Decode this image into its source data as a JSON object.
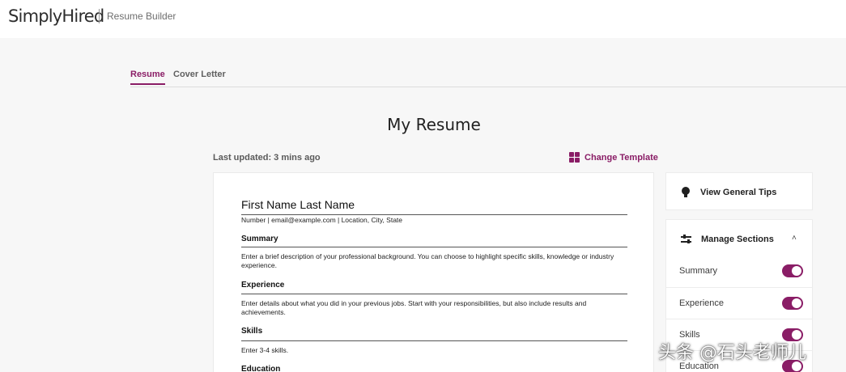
{
  "header": {
    "brand": "SimplyHired",
    "product": "Resume Builder"
  },
  "tabs": [
    {
      "label": "Resume",
      "active": true
    },
    {
      "label": "Cover Letter",
      "active": false
    }
  ],
  "main": {
    "title": "My Resume",
    "last_updated": "Last updated: 3 mins ago",
    "change_template_label": "Change Template",
    "change_template_icon": "grid-icon"
  },
  "resume": {
    "name": "First Name Last Name",
    "contact": "Number | email@example.com | Location, City, State",
    "sections": [
      {
        "heading": "Summary",
        "body": "Enter a brief description of your professional background. You can choose to highlight specific skills, knowledge or industry experience."
      },
      {
        "heading": "Experience",
        "body": "Enter details about what you did in your previous jobs. Start with your responsibilities, but also include results and achievements."
      },
      {
        "heading": "Skills",
        "body": "Enter 3-4 skills."
      },
      {
        "heading": "Education",
        "body": ""
      }
    ]
  },
  "sidebar": {
    "tips_label": "View General Tips",
    "tips_icon": "lightbulb-icon",
    "manage_title": "Manage Sections",
    "manage_icon": "sliders-icon",
    "collapse_glyph": "˄",
    "sections": [
      {
        "label": "Summary",
        "enabled": true
      },
      {
        "label": "Experience",
        "enabled": true
      },
      {
        "label": "Skills",
        "enabled": true
      },
      {
        "label": "Education",
        "enabled": true
      }
    ]
  },
  "watermark": "头条 @石头老师儿",
  "colors": {
    "accent": "#8a1d66",
    "background": "#f7f7f7",
    "card": "#ffffff"
  }
}
